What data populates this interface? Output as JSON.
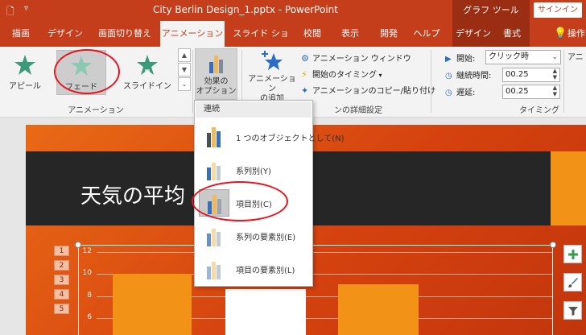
{
  "window": {
    "title": "City Berlin Design_1.pptx - PowerPoint",
    "contextual_title": "グラフ ツール",
    "signin_label": "サインイン"
  },
  "tabs": [
    {
      "label": "描画"
    },
    {
      "label": "デザイン"
    },
    {
      "label": "画面切り替え"
    },
    {
      "label": "アニメーション"
    },
    {
      "label": "スライド ショー"
    },
    {
      "label": "校閲"
    },
    {
      "label": "表示"
    },
    {
      "label": "開発"
    },
    {
      "label": "ヘルプ"
    },
    {
      "label": "デザイン"
    },
    {
      "label": "書式"
    },
    {
      "label": "操作"
    }
  ],
  "animation_gallery": {
    "items": [
      {
        "label": "アピール"
      },
      {
        "label": "フェード"
      },
      {
        "label": "スライドイン"
      }
    ],
    "group_label": "アニメーション"
  },
  "effect_options": {
    "label_line1": "効果の",
    "label_line2": "オプション"
  },
  "advanced": {
    "add_label_line1": "アニメーション",
    "add_label_line2": "の追加",
    "pane_label": "アニメーション ウィンドウ",
    "trigger_label": "開始のタイミング",
    "painter_label": "アニメーションのコピー/貼り付け",
    "group_label": "ンの詳細設定"
  },
  "timing": {
    "start_label": "開始:",
    "start_value": "クリック時",
    "duration_label": "継続時間:",
    "duration_value": "00.25",
    "delay_label": "遅延:",
    "delay_value": "00.25",
    "group_label": "タイミング",
    "next_label": "アニ"
  },
  "dropdown": {
    "header": "連続",
    "items": [
      {
        "label": "1 つのオブジェクトとして(N)"
      },
      {
        "label": "系列別(Y)"
      },
      {
        "label": "項目別(C)"
      },
      {
        "label": "系列の要素別(E)"
      },
      {
        "label": "項目の要素別(L)"
      }
    ]
  },
  "slide": {
    "title": "天気の平均"
  },
  "chart_data": {
    "type": "bar",
    "y_ticks": [
      "12",
      "10",
      "8",
      "6"
    ]
  },
  "sequence_badges": [
    "1",
    "2",
    "3",
    "4",
    "5"
  ]
}
